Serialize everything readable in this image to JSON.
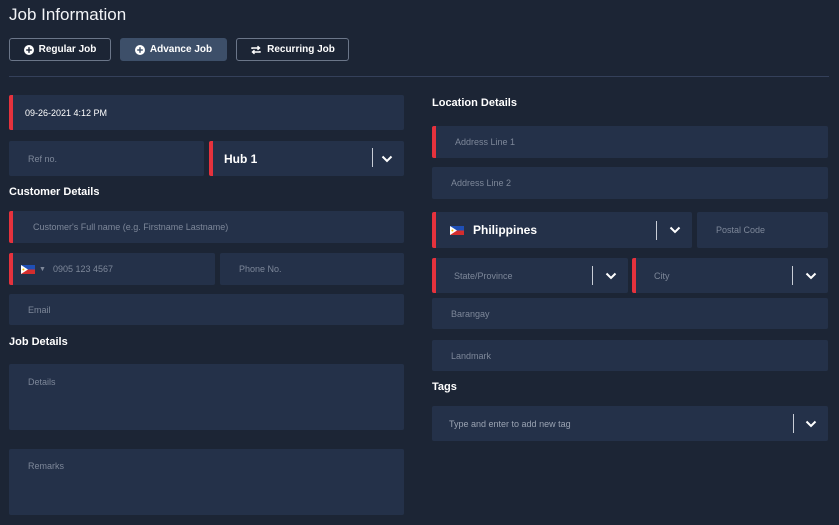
{
  "header": {
    "title": "Job Information"
  },
  "tabs": [
    {
      "label": "Regular Job",
      "icon": "plus-circle-icon"
    },
    {
      "label": "Advance Job",
      "icon": "plus-circle-icon"
    },
    {
      "label": "Recurring Job",
      "icon": "repeat-icon"
    }
  ],
  "job": {
    "datetime": "09-26-2021 4:12 PM",
    "ref_placeholder": "Ref no.",
    "hub_value": "Hub 1"
  },
  "customer": {
    "heading": "Customer Details",
    "fullname_placeholder": "Customer's Full name (e.g. Firstname Lastname)",
    "mobile_placeholder": "0905 123 4567",
    "phone_placeholder": "Phone No.",
    "email_placeholder": "Email",
    "country_flag": "philippines-flag-icon"
  },
  "job_details": {
    "heading": "Job Details",
    "details_placeholder": "Details",
    "remarks_placeholder": "Remarks"
  },
  "location": {
    "heading": "Location Details",
    "address1_placeholder": "Address Line 1",
    "address2_placeholder": "Address Line 2",
    "country_value": "Philippines",
    "postal_placeholder": "Postal Code",
    "state_placeholder": "State/Province",
    "city_placeholder": "City",
    "barangay_placeholder": "Barangay",
    "landmark_placeholder": "Landmark"
  },
  "tags": {
    "heading": "Tags",
    "placeholder": "Type and enter to add new tag"
  },
  "colors": {
    "background": "#1c2535",
    "field": "#243149",
    "required_marker": "#e5323d",
    "active_tab": "#3d4f69"
  }
}
